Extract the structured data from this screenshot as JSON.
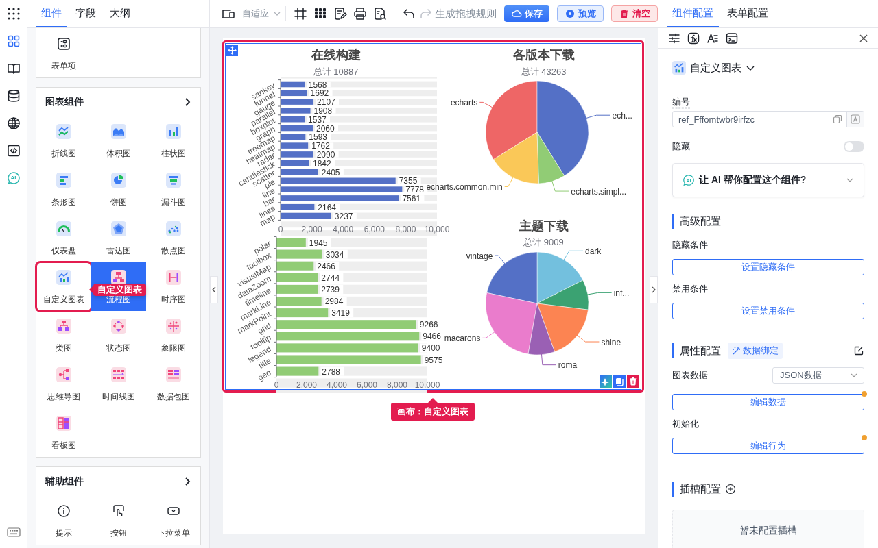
{
  "rail": {
    "items": [
      {
        "kind": "components",
        "selected": true
      },
      {
        "kind": "docs",
        "selected": false
      },
      {
        "kind": "data",
        "selected": false
      },
      {
        "kind": "globe",
        "selected": false
      },
      {
        "kind": "code",
        "selected": false
      },
      {
        "kind": "ai",
        "text": "AI",
        "selected": false
      }
    ]
  },
  "left_panel": {
    "tabs": [
      {
        "label": "组件",
        "selected": true
      },
      {
        "label": "字段",
        "selected": false
      },
      {
        "label": "大纲",
        "selected": false
      }
    ],
    "drag_tooltip": "自定义图表",
    "groups": [
      {
        "items": [
          {
            "label": "表单项",
            "kind": "form",
            "selected": false,
            "dragging": false
          }
        ]
      },
      {
        "title": "图表组件",
        "items": [
          {
            "label": "折线图",
            "kind": "line",
            "selected": false,
            "dragging": false
          },
          {
            "label": "体积图",
            "kind": "area",
            "selected": false,
            "dragging": false
          },
          {
            "label": "柱状图",
            "kind": "column",
            "selected": false,
            "dragging": false
          },
          {
            "label": "条形图",
            "kind": "hbar",
            "selected": false,
            "dragging": false
          },
          {
            "label": "饼图",
            "kind": "pie",
            "selected": false,
            "dragging": false
          },
          {
            "label": "漏斗图",
            "kind": "funnel",
            "selected": false,
            "dragging": false
          },
          {
            "label": "仪表盘",
            "kind": "gauge",
            "selected": false,
            "dragging": false
          },
          {
            "label": "雷达图",
            "kind": "radar",
            "selected": false,
            "dragging": false
          },
          {
            "label": "散点图",
            "kind": "scatter",
            "selected": false,
            "dragging": false
          },
          {
            "label": "自定义图表",
            "kind": "custom",
            "selected": false,
            "dragging": true
          },
          {
            "label": "流程图",
            "kind": "flow",
            "selected": true,
            "dragging": false
          },
          {
            "label": "时序图",
            "kind": "sequence",
            "selected": false,
            "dragging": false
          },
          {
            "label": "类图",
            "kind": "class",
            "selected": false,
            "dragging": false
          },
          {
            "label": "状态图",
            "kind": "state",
            "selected": false,
            "dragging": false
          },
          {
            "label": "象限图",
            "kind": "quadrant",
            "selected": false,
            "dragging": false
          },
          {
            "label": "思维导图",
            "kind": "mindmap",
            "selected": false,
            "dragging": false
          },
          {
            "label": "时间线图",
            "kind": "timeline",
            "selected": false,
            "dragging": false
          },
          {
            "label": "数据包图",
            "kind": "packet",
            "selected": false,
            "dragging": false
          },
          {
            "label": "看板图",
            "kind": "kanban",
            "selected": false,
            "dragging": false
          }
        ]
      },
      {
        "title": "辅助组件",
        "items": [
          {
            "label": "提示",
            "kind": "info",
            "selected": false,
            "dragging": false
          },
          {
            "label": "按钮",
            "kind": "button",
            "selected": false,
            "dragging": false
          },
          {
            "label": "下拉菜单",
            "kind": "dropdown",
            "selected": false,
            "dragging": false
          }
        ]
      }
    ]
  },
  "toolbar": {
    "device_mode": "自适应",
    "redo": {
      "disabled": true
    },
    "rules_label": "生成拖拽规则",
    "buttons": [
      {
        "label": "保存",
        "kind": "primary"
      },
      {
        "label": "预览",
        "kind": "secondary"
      },
      {
        "label": "清空",
        "kind": "danger"
      }
    ]
  },
  "canvas": {
    "online_build": {
      "title": "在线构建",
      "total": "总计 10887",
      "charts": [
        {
          "chart_data": {
            "type": "bar",
            "orientation": "horizontal",
            "data_labels": true,
            "categories": [
              "sankey",
              "funnel",
              "gauge",
              "parallel",
              "boxplot",
              "graph",
              "treemap",
              "heatmap",
              "radar",
              "candlestick",
              "scatter",
              "pie",
              "line",
              "bar",
              "lines",
              "map"
            ],
            "xlim": [
              0,
              10000
            ],
            "xticks": [
              {
                "value": 0,
                "label": "0"
              },
              {
                "value": 2000,
                "label": "2,000"
              },
              {
                "value": 4000,
                "label": "4,000"
              },
              {
                "value": 6000,
                "label": "6,000"
              },
              {
                "value": 8000,
                "label": "8,000"
              },
              {
                "value": 10000,
                "label": "10,000"
              }
            ],
            "series": [
              {
                "color": "#5470c6",
                "values": [
                  1568,
                  1692,
                  2107,
                  1908,
                  1537,
                  2060,
                  1593,
                  1762,
                  2090,
                  1842,
                  2405,
                  7355,
                  7778,
                  7561,
                  2164,
                  3237
                ]
              }
            ]
          }
        },
        {
          "chart_data": {
            "type": "bar",
            "orientation": "horizontal",
            "data_labels": true,
            "categories": [
              "polar",
              "toolbox",
              "visualMap",
              "dataZoom",
              "timeline",
              "markLine",
              "markPoint",
              "grid",
              "tooltip",
              "legend",
              "title",
              "geo"
            ],
            "xlim": [
              0,
              10000
            ],
            "xticks": [
              {
                "value": 0,
                "label": "0"
              },
              {
                "value": 2000,
                "label": "2,000"
              },
              {
                "value": 4000,
                "label": "4,000"
              },
              {
                "value": 6000,
                "label": "6,000"
              },
              {
                "value": 8000,
                "label": "8,000"
              },
              {
                "value": 10000,
                "label": "10,000"
              }
            ],
            "series": [
              {
                "color": "#91cc75",
                "values": [
                  1945,
                  3034,
                  2466,
                  2744,
                  2739,
                  2984,
                  3419,
                  9266,
                  9466,
                  9400,
                  9575,
                  2788
                ]
              }
            ]
          }
        }
      ]
    },
    "pies": [
      {
        "title": "各版本下载",
        "total": "总计 43263",
        "slices": [
          {
            "label": "echarts",
            "color": "#ee6666"
          },
          {
            "label": "ech...",
            "color": "#5470c6"
          },
          {
            "label": "echarts.common.min",
            "color": "#fac858"
          },
          {
            "label": "echarts.simpl...",
            "color": "#91cc75"
          }
        ]
      },
      {
        "title": "主题下载",
        "total": "总计 9009",
        "slices": [
          {
            "label": "dark",
            "color": "#73c0de"
          },
          {
            "label": "vintage",
            "color": "#5470c6"
          },
          {
            "label": "inf...",
            "color": "#3ba272"
          },
          {
            "label": "macarons",
            "color": "#ea7ccc"
          },
          {
            "label": "shine",
            "color": "#fc8452"
          },
          {
            "label": "roma",
            "color": "#9a60b4"
          }
        ]
      }
    ],
    "frame_tag": "画布：自定义图表"
  },
  "config_panel": {
    "tabs": [
      {
        "label": "组件配置",
        "selected": true
      },
      {
        "label": "表单配置",
        "selected": false
      }
    ],
    "component_type": "自定义图表",
    "id_field": {
      "label": "编号",
      "value": "ref_Fffomtwbr9irfzc"
    },
    "hidden_toggle": {
      "label": "隐藏",
      "on": false
    },
    "ai_assist": {
      "badge": "AI",
      "text": "让 AI 帮你配置这个组件?",
      "expanded": false
    },
    "advanced": {
      "title": "高级配置",
      "rows": [
        {
          "label": "隐藏条件",
          "button": "设置隐藏条件",
          "modified": false
        },
        {
          "label": "禁用条件",
          "button": "设置禁用条件",
          "modified": false
        }
      ]
    },
    "properties": {
      "title": "属性配置",
      "badge": "数据绑定",
      "rows": [
        {
          "label": "图表数据",
          "select": "JSON数据",
          "button": "编辑数据",
          "modified": true
        },
        {
          "label": "初始化",
          "button": "编辑行为",
          "modified": true
        }
      ]
    },
    "slots": {
      "title": "插槽配置",
      "empty_text": "暂未配置插槽"
    }
  }
}
